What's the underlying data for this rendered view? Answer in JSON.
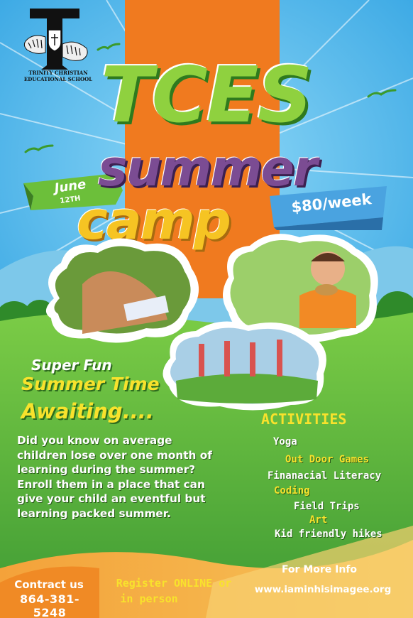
{
  "logo": {
    "letter": "T",
    "caption_line1": "TRINITY CHRISTIAN",
    "caption_line2": "EDUCATIONAL SCHOOL"
  },
  "title": {
    "line1": "TCES",
    "line2": "summer",
    "line3": "camp"
  },
  "date_ribbon": {
    "month": "June",
    "day": "12TH"
  },
  "price_ribbon": {
    "price": "$80/week"
  },
  "tagline": {
    "line1": "Super Fun",
    "line2": "Summer Time",
    "line3": "Awaiting...."
  },
  "body_text": "Did you know on average children lose over one month of learning during the summer? Enroll them in a place that can give your child an eventful but learning packed summer.",
  "activities": {
    "heading": "ACTIVITIES",
    "items": [
      {
        "label": "Yoga",
        "color": "#ffffff"
      },
      {
        "label": "Out Door Games",
        "color": "#f8e22c"
      },
      {
        "label": "Finanacial Literacy",
        "color": "#ffffff"
      },
      {
        "label": "Coding",
        "color": "#f8e22c"
      },
      {
        "label": "Field Trips",
        "color": "#ffffff"
      },
      {
        "label": "Art",
        "color": "#f8e22c"
      },
      {
        "label": "Kid friendly hikes",
        "color": "#ffffff"
      }
    ]
  },
  "contact": {
    "label": "Contract us",
    "phone": "864-381-5248"
  },
  "register": {
    "line1": "Register ONLINE or",
    "line2": "in person"
  },
  "more_info": {
    "label": "For More Info",
    "website": "www.iaminhisimagee.org"
  },
  "colors": {
    "sky": "#4fb6ea",
    "stripe_orange": "#f07a1f",
    "grass_green": "#5cb83a",
    "title_green": "#8fd13f",
    "title_purple": "#7b4c93",
    "title_yellow": "#f6c423",
    "highlight_yellow": "#f8e22c"
  }
}
